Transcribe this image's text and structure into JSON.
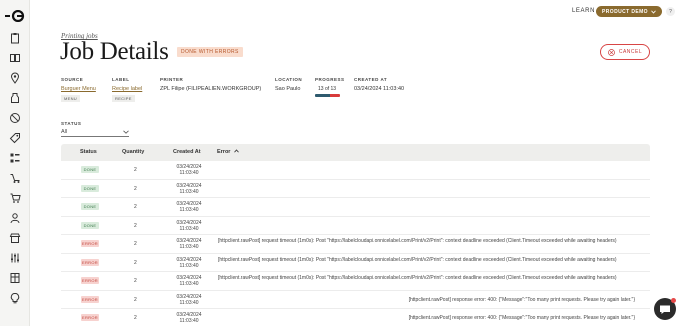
{
  "topbar": {
    "learn_label": "LEARN",
    "demo_label": "PRODUCT DEMO",
    "help_label": "?"
  },
  "header": {
    "breadcrumb": "Printing jobs",
    "title": "Job Details",
    "status_badge": "DONE WITH ERRORS",
    "cancel_label": "CANCEL"
  },
  "meta": {
    "source_label": "SOURCE",
    "source_value": "Burguer Menu",
    "source_tag": "MENU",
    "label_label": "LABEL",
    "label_value": "Recipe label",
    "label_tag": "RECIPE",
    "printer_label": "PRINTER",
    "printer_value": "ZPL Filipe (FILIPEALIEN.WORKGROUP)",
    "location_label": "LOCATION",
    "location_value": "Sao Paulo",
    "progress_label": "PROGRESS",
    "progress_value": "13 of 13",
    "progress_ok_fraction": 0.6,
    "progress_err_fraction": 0.4,
    "created_label": "CREATED AT",
    "created_value": "03/24/2024 11:03:40"
  },
  "filter": {
    "label": "STATUS",
    "value": "All"
  },
  "table": {
    "headers": {
      "status": "Status",
      "quantity": "Quantity",
      "created": "Created At",
      "error": "Error"
    },
    "rows": [
      {
        "status": "DONE",
        "qty": "2",
        "date": "03/24/2024",
        "time": "11:03:40",
        "error": ""
      },
      {
        "status": "DONE",
        "qty": "2",
        "date": "03/24/2024",
        "time": "11:03:40",
        "error": ""
      },
      {
        "status": "DONE",
        "qty": "2",
        "date": "03/24/2024",
        "time": "11:03:40",
        "error": ""
      },
      {
        "status": "DONE",
        "qty": "2",
        "date": "03/24/2024",
        "time": "11:03:40",
        "error": ""
      },
      {
        "status": "ERROR",
        "qty": "2",
        "date": "03/24/2024",
        "time": "11:03:40",
        "error": "[httpclient.rawPost] request timeout (1m0s): Post \"https://labelcloudapi.onnicelabel.com/Print/v2/Print\": context deadline exceeded (Client.Timeout exceeded while awaiting headers)"
      },
      {
        "status": "ERROR",
        "qty": "2",
        "date": "03/24/2024",
        "time": "11:03:40",
        "error": "[httpclient.rawPost] request timeout (1m0s): Post \"https://labelcloudapi.onnicelabel.com/Print/v2/Print\": context deadline exceeded (Client.Timeout exceeded while awaiting headers)"
      },
      {
        "status": "ERROR",
        "qty": "2",
        "date": "03/24/2024",
        "time": "11:03:40",
        "error": "[httpclient.rawPost] request timeout (1m0s): Post \"https://labelcloudapi.onnicelabel.com/Print/v2/Print\": context deadline exceeded (Client.Timeout exceeded while awaiting headers)"
      },
      {
        "status": "ERROR",
        "qty": "2",
        "date": "03/24/2024",
        "time": "11:03:40",
        "error": "[httpclient.rawPost] response error: 400: {\"Message\":\"Too many print requests. Please try again later.\"}"
      },
      {
        "status": "ERROR",
        "qty": "2",
        "date": "03/24/2024",
        "time": "11:03:40",
        "error": "[httpclient.rawPost] response error: 400: {\"Message\":\"Too many print requests. Please try again later.\"}"
      }
    ]
  }
}
